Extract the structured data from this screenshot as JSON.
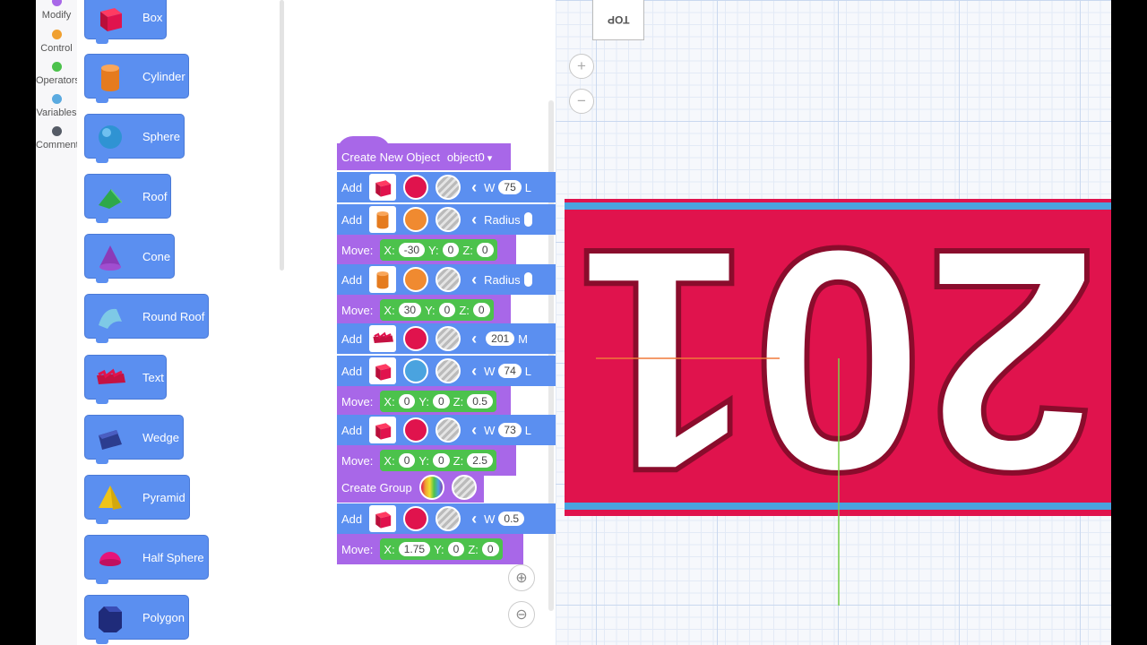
{
  "categories": [
    {
      "label": "Modify",
      "color": "#a867e8"
    },
    {
      "label": "Control",
      "color": "#f0a030"
    },
    {
      "label": "Operators",
      "color": "#4cc24c"
    },
    {
      "label": "Variables",
      "color": "#5aaae0"
    },
    {
      "label": "Comment",
      "color": "#555b66"
    }
  ],
  "palette": [
    {
      "label": "Box",
      "icon": "box-icon"
    },
    {
      "label": "Cylinder",
      "icon": "cylinder-icon"
    },
    {
      "label": "Sphere",
      "icon": "sphere-icon"
    },
    {
      "label": "Roof",
      "icon": "roof-icon"
    },
    {
      "label": "Cone",
      "icon": "cone-icon"
    },
    {
      "label": "Round Roof",
      "icon": "round-roof-icon"
    },
    {
      "label": "Text",
      "icon": "text-shape-icon"
    },
    {
      "label": "Wedge",
      "icon": "wedge-icon"
    },
    {
      "label": "Pyramid",
      "icon": "pyramid-icon"
    },
    {
      "label": "Half Sphere",
      "icon": "half-sphere-icon"
    },
    {
      "label": "Polygon",
      "icon": "polygon-icon"
    }
  ],
  "script": {
    "create_label": "Create New Object",
    "object_name": "object0",
    "rows": [
      {
        "kind": "add",
        "label": "Add",
        "shape": "box",
        "color": "#e0134d",
        "param": "W",
        "value": "75",
        "trail": "L"
      },
      {
        "kind": "add",
        "label": "Add",
        "shape": "cylinder",
        "color": "#f08a30",
        "param": "Radius",
        "value": "",
        "trail": ""
      },
      {
        "kind": "move",
        "label": "Move:",
        "x": "-30",
        "y": "0",
        "z": "0"
      },
      {
        "kind": "add",
        "label": "Add",
        "shape": "cylinder",
        "color": "#f08a30",
        "param": "Radius",
        "value": "",
        "trail": ""
      },
      {
        "kind": "move",
        "label": "Move:",
        "x": "30",
        "y": "0",
        "z": "0"
      },
      {
        "kind": "add",
        "label": "Add",
        "shape": "text",
        "color": "#e0134d",
        "param": "",
        "value": "201",
        "trail": "M"
      },
      {
        "kind": "add",
        "label": "Add",
        "shape": "box",
        "color": "#4aa3df",
        "param": "W",
        "value": "74",
        "trail": "L"
      },
      {
        "kind": "move",
        "label": "Move:",
        "x": "0",
        "y": "0",
        "z": "0.5"
      },
      {
        "kind": "add",
        "label": "Add",
        "shape": "box",
        "color": "#e0134d",
        "param": "W",
        "value": "73",
        "trail": "L"
      },
      {
        "kind": "move",
        "label": "Move:",
        "x": "0",
        "y": "0",
        "z": "2.5"
      },
      {
        "kind": "group",
        "label": "Create Group"
      },
      {
        "kind": "add",
        "label": "Add",
        "shape": "box",
        "color": "#e0134d",
        "param": "W",
        "value": "0.5",
        "trail": ""
      },
      {
        "kind": "move",
        "label": "Move:",
        "x": "1.75",
        "y": "0",
        "z": "0"
      }
    ]
  },
  "viewport": {
    "view_cube_label": "TOP",
    "zoom_in": "+",
    "zoom_out": "−",
    "plate_text": "201",
    "plate_color": "#e0134d",
    "stripe_color": "#4aa3df"
  },
  "workspace_zoom": {
    "in": "+",
    "out": "−"
  }
}
